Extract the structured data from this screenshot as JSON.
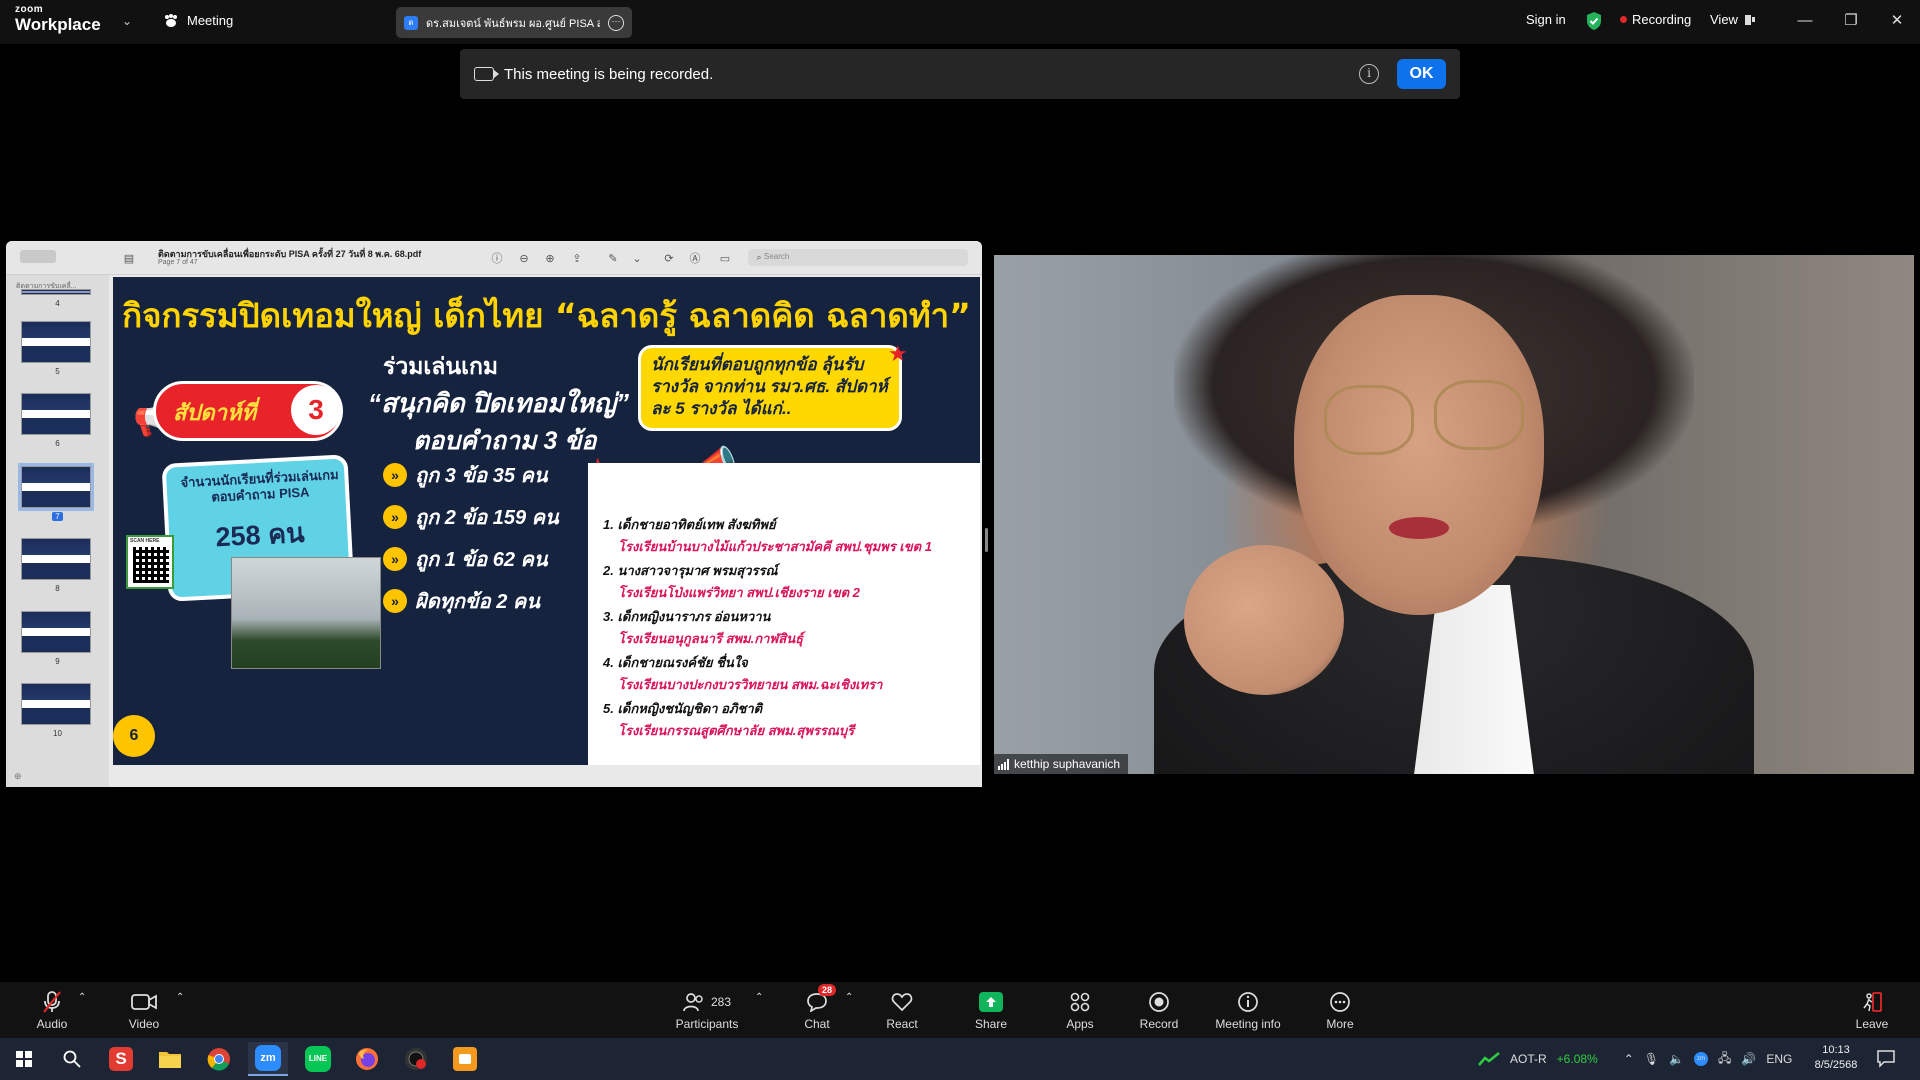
{
  "topbar": {
    "brand_small": "zoom",
    "brand_big": "Workplace",
    "meeting_label": "Meeting",
    "share_tab_text": "ดร.สมเจตน์ พันธ์พรม ผอ.ศูนย์ PISA ส",
    "sign_in": "Sign in",
    "recording": "Recording",
    "view": "View"
  },
  "banner": {
    "message": "This meeting is being recorded.",
    "ok": "OK"
  },
  "pdf": {
    "title": "ติดตามการขับเคลื่อนเพื่อยกระดับ PISA ครั้งที่ 27 วันที่ 8 พ.ค. 68.pdf",
    "page_info": "Page 7 of 47",
    "search_placeholder": "Search",
    "sidebar_top": "ติดตามการขับเคลื่...",
    "thumbnails": [
      "4",
      "5",
      "6",
      "7",
      "8",
      "9",
      "10"
    ],
    "selected_page": "7"
  },
  "slide": {
    "title": "กิจกรรมปิดเทอมใหญ่ เด็กไทย “ฉลาดรู้ ฉลาดคิด ฉลาดทำ”",
    "week_text": "สัปดาห์ที่",
    "week_num": "3",
    "game_title": "ร่วมเล่นเกม",
    "game_name": "“สนุกคิด ปิดเทอมใหญ่”",
    "game_q": "ตอบคำถาม 3 ข้อ",
    "count_label": "จำนวนนักเรียนที่ร่วมเล่นเกม ตอบคำถาม PISA",
    "count_value": "258 คน",
    "scores": [
      "ถูก 3 ข้อ   35   คน",
      "ถูก 2 ข้อ  159   คน",
      "ถูก 1 ข้อ   62   คน",
      "ผิดทุกข้อ   2 คน"
    ],
    "reward": "นักเรียนที่ตอบถูกทุกข้อ ลุ้นรับรางวัล จากท่าน รมว.ศธ. สัปดาห์ละ 5 รางวัล ได้แก่..",
    "winners": [
      {
        "name": "1. เด็กชายอาทิตย์เทพ สังฆทิพย์",
        "school": "โรงเรียนบ้านบางไม้แก้วประชาสามัคคี   สพป.ชุมพร เขต 1"
      },
      {
        "name": "2. นางสาวจารุมาศ พรมสุวรรณ์",
        "school": "โรงเรียนโป่งแพร่วิทยา   สพป.เชียงราย เขต 2"
      },
      {
        "name": "3. เด็กหญิงนาราภร อ่อนหวาน",
        "school": "โรงเรียนอนุกูลนารี   สพม.กาฬสินธุ์"
      },
      {
        "name": "4. เด็กชายณรงค์ชัย ชื่นใจ",
        "school": "โรงเรียนบางปะกงบวรวิทยายน   สพม.ฉะเชิงเทรา"
      },
      {
        "name": "5. เด็กหญิงชนัญชิดา อภิชาติ",
        "school": "โรงเรียนกรรณสูตศึกษาลัย   สพม.สุพรรณบุรี"
      }
    ],
    "qr_label": "SCAN HERE",
    "page_badge": "6"
  },
  "video": {
    "participant_name": "ketthip suphavanich"
  },
  "toolbar": {
    "audio": "Audio",
    "video": "Video",
    "participants": "Participants",
    "participants_count": "283",
    "chat": "Chat",
    "chat_badge": "28",
    "react": "React",
    "share": "Share",
    "apps": "Apps",
    "record": "Record",
    "meeting_info": "Meeting info",
    "more": "More",
    "leave": "Leave"
  },
  "taskbar": {
    "stock_name": "AOT-R",
    "stock_change": "+6.08%",
    "language": "ENG",
    "time": "10:13",
    "date": "8/5/2568"
  },
  "colors": {
    "zoom_blue": "#0e72ed",
    "recording_red": "#e02828",
    "share_green": "#10b45a",
    "slide_navy": "#15233f",
    "slide_yellow": "#ffd400",
    "stock_green": "#2ecc40"
  }
}
